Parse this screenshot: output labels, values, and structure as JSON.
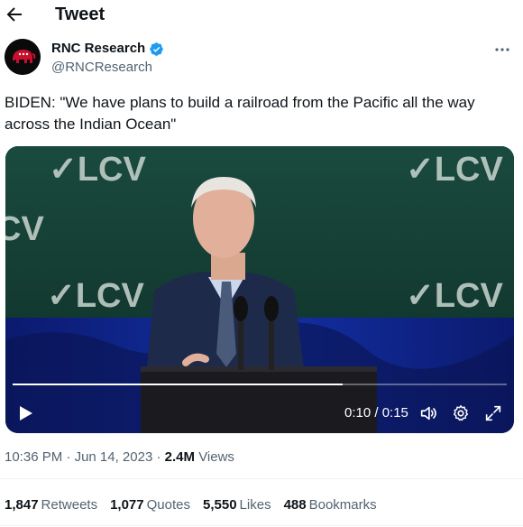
{
  "header": {
    "title": "Tweet",
    "back_icon": "arrow-left-icon"
  },
  "author": {
    "name": "RNC Research",
    "handle": "@RNCResearch",
    "verified_icon": "verified-badge-icon",
    "verified_color": "#1d9bf0",
    "avatar_icon": "republican-elephant-icon",
    "avatar_color": "#c8102e"
  },
  "tweet": {
    "text": "BIDEN: \"We have plans to build a railroad from the Pacific all the way across the Indian Ocean\""
  },
  "video": {
    "backdrop_logo": "✓LCV",
    "current_time": "0:10",
    "duration": "0:15",
    "time_display": "0:10 / 0:15",
    "progress_fraction": 0.667
  },
  "meta": {
    "time": "10:36 PM",
    "date": "Jun 14, 2023",
    "views_count": "2.4M",
    "views_label": "Views",
    "separator": "·"
  },
  "stats": [
    {
      "count": "1,847",
      "label": "Retweets"
    },
    {
      "count": "1,077",
      "label": "Quotes"
    },
    {
      "count": "5,550",
      "label": "Likes"
    },
    {
      "count": "488",
      "label": "Bookmarks"
    }
  ],
  "colors": {
    "text": "#0f1419",
    "secondary": "#536471",
    "divider": "#eff3f4"
  }
}
